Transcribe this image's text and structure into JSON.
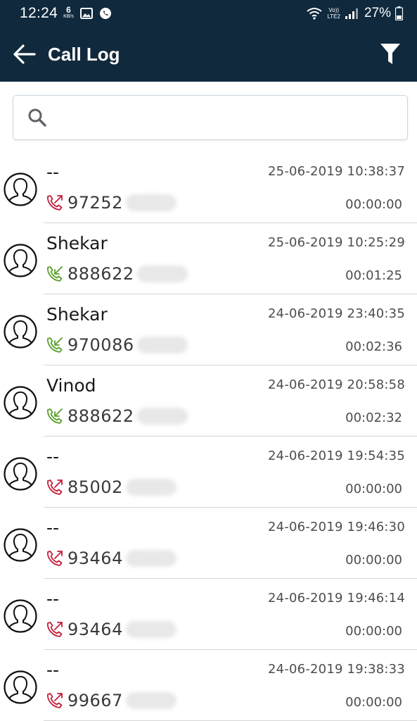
{
  "status_bar": {
    "time": "12:24",
    "net_speed_value": "6",
    "net_speed_unit": "KB/s",
    "volte_top": "Vo))",
    "volte_bottom": "LTE2",
    "battery": "27%"
  },
  "app_bar": {
    "title": "Call Log",
    "back_icon": "arrow-left-icon",
    "filter_icon": "filter-icon"
  },
  "search": {
    "placeholder": "",
    "value": "",
    "icon": "search-icon"
  },
  "colors": {
    "header_bg": "#10293d",
    "outgoing": "#c21e3a",
    "incoming": "#5a9f2a",
    "divider": "#d6d6d6"
  },
  "calls": [
    {
      "name": "--",
      "number": "97252",
      "datetime": "25-06-2019 10:38:37",
      "duration": "00:00:00",
      "type": "outgoing"
    },
    {
      "name": "Shekar",
      "number": "888622",
      "datetime": "25-06-2019 10:25:29",
      "duration": "00:01:25",
      "type": "incoming"
    },
    {
      "name": "Shekar",
      "number": "970086",
      "datetime": "24-06-2019 23:40:35",
      "duration": "00:02:36",
      "type": "incoming"
    },
    {
      "name": "Vinod",
      "number": "888622",
      "datetime": "24-06-2019 20:58:58",
      "duration": "00:02:32",
      "type": "incoming"
    },
    {
      "name": "--",
      "number": "85002",
      "datetime": "24-06-2019 19:54:35",
      "duration": "00:00:00",
      "type": "outgoing"
    },
    {
      "name": "--",
      "number": "93464",
      "datetime": "24-06-2019 19:46:30",
      "duration": "00:00:00",
      "type": "outgoing"
    },
    {
      "name": "--",
      "number": "93464",
      "datetime": "24-06-2019 19:46:14",
      "duration": "00:00:00",
      "type": "outgoing"
    },
    {
      "name": "--",
      "number": "99667",
      "datetime": "24-06-2019 19:38:33",
      "duration": "00:00:00",
      "type": "outgoing"
    }
  ]
}
